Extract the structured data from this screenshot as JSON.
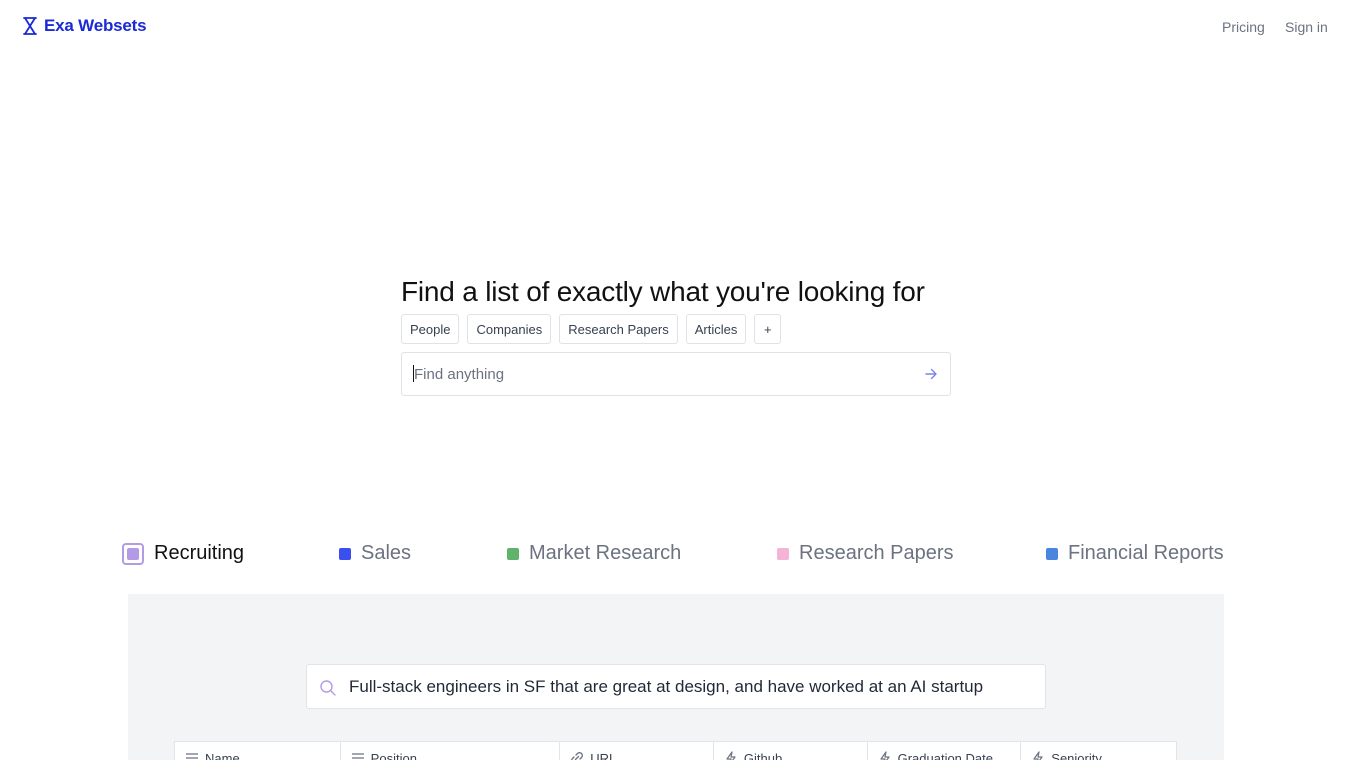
{
  "brand": {
    "name": "Exa Websets",
    "color": "#1a2ad6",
    "icon": "hourglass-logo-icon"
  },
  "nav": {
    "pricing": "Pricing",
    "sign_in": "Sign in"
  },
  "hero": {
    "title": "Find a list of exactly what you're looking for",
    "chips": [
      "People",
      "Companies",
      "Research Papers",
      "Articles",
      "+"
    ],
    "search": {
      "placeholder": "Find anything",
      "value": "",
      "submit_icon": "arrow-right-icon"
    }
  },
  "categories": [
    {
      "label": "Recruiting",
      "color": "#b39ae6",
      "active": true
    },
    {
      "label": "Sales",
      "color": "#3b4ff0",
      "active": false
    },
    {
      "label": "Market Research",
      "color": "#5fb36a",
      "active": false
    },
    {
      "label": "Research Papers",
      "color": "#f5b3d6",
      "active": false
    },
    {
      "label": "Financial Reports",
      "color": "#4a86e0",
      "active": false
    }
  ],
  "demo": {
    "query": "Full-stack engineers in SF that are great at design, and have worked at an AI startup",
    "query_icon": "search-icon",
    "columns": [
      {
        "label": "Name",
        "icon": "text-lines-icon"
      },
      {
        "label": "Position",
        "icon": "text-lines-icon"
      },
      {
        "label": "URL",
        "icon": "link-icon"
      },
      {
        "label": "Github",
        "icon": "enrichment-icon"
      },
      {
        "label": "Graduation Date",
        "icon": "enrichment-icon"
      },
      {
        "label": "Seniority",
        "icon": "enrichment-icon"
      }
    ]
  }
}
